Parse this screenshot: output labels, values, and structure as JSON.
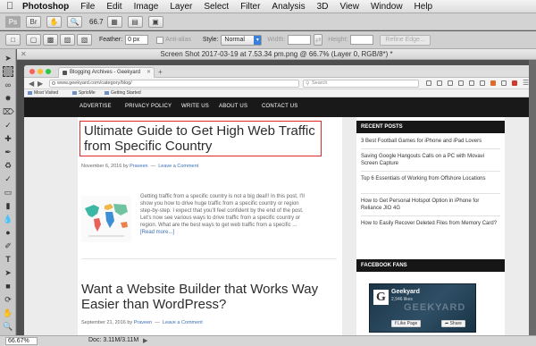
{
  "menubar": {
    "app_name": "Photoshop",
    "items": [
      "File",
      "Edit",
      "Image",
      "Layer",
      "Select",
      "Filter",
      "Analysis",
      "3D",
      "View",
      "Window",
      "Help"
    ]
  },
  "toolbar1": {
    "logo": "Ps",
    "zoom": "66.7"
  },
  "options": {
    "feather_label": "Feather:",
    "feather_value": "0 px",
    "antialias_label": "Anti-alias",
    "style_label": "Style:",
    "style_value": "Normal",
    "width_label": "Width:",
    "height_label": "Height:",
    "refine_edge": "Refine Edge..."
  },
  "document": {
    "title": "Screen Shot 2017-03-19 at 7.53.34 pm.png @ 66.7% (Layer 0, RGB/8*) *"
  },
  "browser": {
    "tab_title": "Blogging Archives - Geekyard",
    "url": "www.geekyard.com/category/blog/",
    "search_placeholder": "Search",
    "bookmarks": [
      "Most Visited",
      "SprioMe",
      "Getting Started"
    ]
  },
  "site": {
    "nav": [
      "ADVERTISE",
      "PRIVACY POLICY",
      "WRITE US",
      "ABOUT US",
      "CONTACT US"
    ],
    "post1": {
      "title_line1": "Ultimate Guide to Get High Web Traffic",
      "title_line2": "from Specific Country",
      "date": "November 6, 2016",
      "by": "by",
      "author": "Praveen",
      "comment": "Leave a Comment",
      "excerpt": [
        "Getting traffic from a specific country is not a big deal!! In this post, I'll",
        "show you how to drive huge traffic from a specific country or region",
        "step-by-step. I expect that you'll feel confident by the end of the post.",
        "Let's now see various ways to drive traffic from a specific country or",
        "region. What are the best ways to get web traffic from a specific ..."
      ],
      "read_more": "[Read more...]"
    },
    "post2": {
      "title_line1": "Want a Website Builder that Works Way",
      "title_line2": "Easier than WordPress?",
      "date": "September 21, 2016",
      "by": "by",
      "author": "Praveen",
      "comment": "Leave a Comment"
    },
    "sidebar": {
      "recent_heading": "RECENT POSTS",
      "recent_posts": [
        "3 Best Football Games for iPhone and iPad Lovers",
        "Saving Google Hangouts Calls on a PC with Movavi Screen Capture",
        "Top 6 Essentials of Working from Offshore Locations",
        "How to Get Personal Hotspot Option in iPhone for Reliance JIO 4G",
        "How to Easily Recover Deleted Files from Memory Card?"
      ],
      "fans_heading": "FACEBOOK FANS",
      "fb_page_name": "Geekyard",
      "fb_likes": "2,946 likes",
      "fb_watermark": "GEEKYARD",
      "fb_like_button": "Like Page",
      "fb_share_button": "Share"
    }
  },
  "statusbar": {
    "zoom": "66.67%",
    "doc_size": "Doc: 3.11M/3.11M"
  }
}
